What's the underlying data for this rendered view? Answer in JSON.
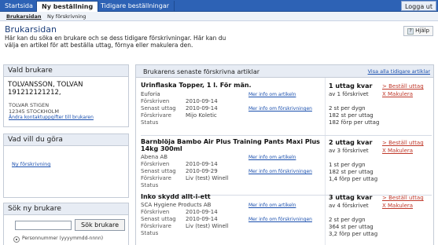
{
  "top_tabs": [
    "Startsida",
    "Ny beställning",
    "Tidigare beställningar"
  ],
  "logout_label": "Logga ut",
  "sub_tabs": [
    "Brukarsidan",
    "Ny förskrivning"
  ],
  "page_title": "Brukarsidan",
  "help_label": "Hjälp",
  "intro": "Här kan du söka en brukare och se dess tidigare förskrivningar. Här kan du välja en artikel för att beställa uttag, förnya eller makulera den.",
  "customer": {
    "heading": "Vald brukare",
    "name": "TOLVANSSON, TOLVAN",
    "pnr": "191212121212,",
    "address1": "TOLVAR STIGEN",
    "address2": "12345 STOCKHOLM",
    "contact_link": "Ändra kontaktuppgifter till brukaren"
  },
  "todo": {
    "heading": "Vad vill du göra",
    "new_link": "Ny förskrivning"
  },
  "search": {
    "heading": "Sök ny brukare",
    "button": "Sök brukare",
    "input_value": "",
    "option_label": "Personnummer (yyyymmdd-nnnn)"
  },
  "list": {
    "heading": "Brukarens senaste förskrivna artiklar",
    "all_link": "Visa alla tidigare artiklar",
    "labels": {
      "prescribed": "Förskriven",
      "last": "Senast uttag",
      "prescriber": "Förskrivare",
      "status": "Status"
    },
    "info_article": "Mer info om artikeln",
    "info_prescription": "Mer info om förskrivningen",
    "order": "> Beställ uttag",
    "cancel": "X Makulera",
    "items": [
      {
        "name": "Urinflaska Topper, 1 l. För män.",
        "manufacturer": "Euforia",
        "prescribed": "2010-09-14",
        "last": "2010-09-14",
        "prescriber": "Mijo Koletic",
        "remaining": "1 uttag kvar",
        "remaining_sub": [
          "av 1 förskrivet",
          "",
          "2 st per dygn",
          "182 st per uttag",
          "182 förp per uttag"
        ]
      },
      {
        "name": "Barnblöja Bambo Air Plus Training Pants Maxi Plus 14kg 300ml",
        "manufacturer": "Abena AB",
        "prescribed": "2010-09-14",
        "last": "2010-09-29",
        "prescriber": "Liv (test) Winell",
        "remaining": "2 uttag kvar",
        "remaining_sub": [
          "av 3 förskrivet",
          "",
          "1 st per dygn",
          "182 st per uttag",
          "1,4 förp per uttag"
        ]
      },
      {
        "name": "Inko skydd allt-i-ett",
        "manufacturer": "SCA Hygiene Products AB",
        "prescribed": "2010-09-14",
        "last": "2010-09-14",
        "prescriber": "Liv (test) Winell",
        "remaining": "3 uttag kvar",
        "remaining_sub": [
          "av 4 förskrivet",
          "",
          "2 st per dygn",
          "364 st per uttag",
          "3,2 förp per uttag"
        ]
      }
    ]
  }
}
